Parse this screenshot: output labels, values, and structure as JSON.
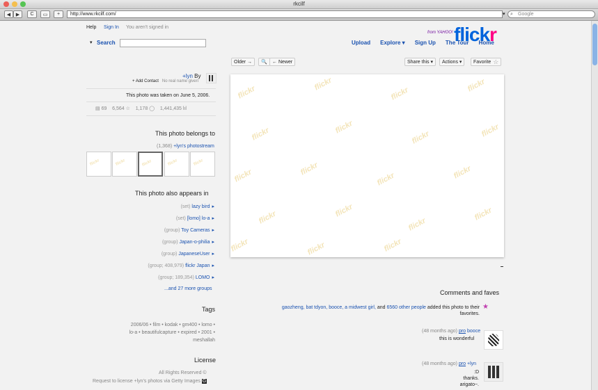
{
  "window": {
    "title": "rkcilf"
  },
  "browser": {
    "url": "http://www.rkcilf.com/",
    "search_placeholder": "Google",
    "back_label": "◀",
    "forward_label": "▶",
    "reload_label": "C",
    "plus_label": "+",
    "dropdown_label": "▾"
  },
  "header": {
    "logo_part1": "flick",
    "logo_part2": "r",
    "logo_sub": "from YAHOO!",
    "account_status": "You aren't signed in",
    "sign_in": "Sign In",
    "help": "Help",
    "nav": [
      "Home",
      "The Tour",
      "Sign Up",
      "Explore ▾",
      "Upload"
    ],
    "search_label": "Search",
    "search_caret": "▾"
  },
  "photo_toolbar": {
    "fave": "Favorite",
    "actions": "Actions ▾",
    "share": "Share this ▾",
    "newer": "← Newer",
    "zoom": "🔍",
    "older": "Older →",
    "watermark": "flickr"
  },
  "owner": {
    "by_label": "By",
    "name": "+lyn",
    "real_name": "No real name given",
    "add_contact": "+ Add Contact"
  },
  "photo_info": {
    "taken": "This photo was taken on June 5, 2006.",
    "views": "1,441,435",
    "comments": "1,178",
    "faves": "6,564",
    "notes": "69"
  },
  "photostream": {
    "heading": "This photo belongs to",
    "owner_link": "+lyn's photostream",
    "count": "(1,368)"
  },
  "appears_in": {
    "heading": "This photo also appears in",
    "items": [
      {
        "name": "lazy bird",
        "type": "(set)"
      },
      {
        "name": "[lomo] lo-a",
        "type": "(set)"
      },
      {
        "name": "Toy Cameras",
        "type": "(group)"
      },
      {
        "name": "Japan-o-philia",
        "type": "(group)"
      },
      {
        "name": "JapaneseUser",
        "type": "(group)"
      },
      {
        "name": "flickr Japan",
        "type": "(group; 408,979)"
      },
      {
        "name": "LOMO",
        "type": "(group; 189,354)"
      }
    ],
    "more": "...and 27 more groups"
  },
  "tags": {
    "heading": "Tags",
    "lines": [
      "2006/06 • film • kodak • gm400 • lomo •",
      "lo-a • beautifulcapture • expired • 2001 •",
      "meshallah"
    ]
  },
  "license": {
    "heading": "License",
    "rights": "All Rights Reserved",
    "getty": "Request to license +lyn's photos via Getty Images"
  },
  "comments": {
    "heading": "Comments and faves",
    "faved_people": "gaozheng, bat tdyon, booce, a midwest girl,",
    "faved_and": "and",
    "faved_others": "6560 other people",
    "faved_text": "added this photo to their favorites.",
    "entries": [
      {
        "user": "booce",
        "badge": "pro",
        "time": "(48 months ago)",
        "lines": [
          "this is wonderful"
        ]
      },
      {
        "user": "+lyn",
        "badge": "pro",
        "time": "(48 months ago)",
        "lines": [
          ":D",
          "thanks.",
          "arigato~."
        ]
      }
    ]
  },
  "colors": {
    "accent_blue": "#0063dc",
    "accent_pink": "#ff0084",
    "link": "#1a52b0"
  }
}
